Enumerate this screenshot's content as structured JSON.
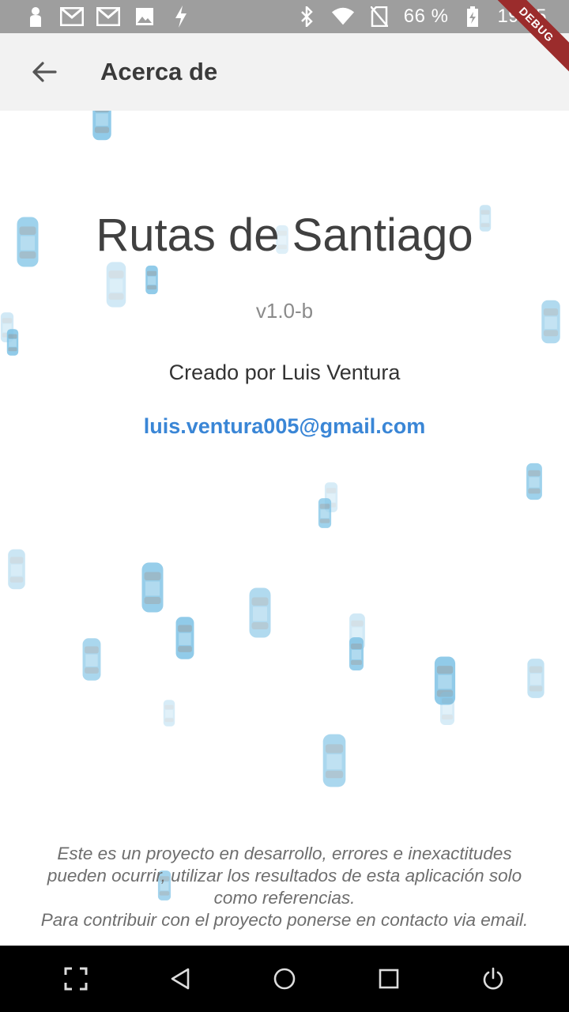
{
  "status_bar": {
    "battery": "66 %",
    "time": "19:25",
    "debug_label": "DEBUG",
    "left_icons": [
      "person-icon",
      "gmail-icon",
      "gmail-icon",
      "image-icon",
      "flash-icon"
    ],
    "right_icons": [
      "bluetooth-icon",
      "wifi-icon",
      "no-sim-icon",
      "battery-icon"
    ]
  },
  "app_bar": {
    "title": "Acerca de",
    "back_icon": "arrow-back-icon"
  },
  "about": {
    "app_name": "Rutas de Santiago",
    "version": "v1.0-b",
    "author": "Creado por Luis Ventura",
    "email": "luis.ventura005@gmail.com"
  },
  "footer": {
    "line1": "Este es un proyecto en desarrollo, errores e inexactitudes",
    "line2": "pueden ocurrir, utilizar los resultados de esta aplicación solo",
    "line3": "como referencias.",
    "line4": "Para contribuir con el proyecto ponerse en contacto via email."
  },
  "nav_bar": {
    "buttons": [
      "screenshot-icon",
      "back-triangle-icon",
      "home-circle-icon",
      "recents-square-icon",
      "power-icon"
    ]
  },
  "colors": {
    "status_bar": "#9e9e9e",
    "app_bar": "#f2f2f2",
    "link": "#3a86d6",
    "car": "#7ec3e6",
    "debug_ribbon": "#9b2c2c",
    "nav_bar": "#000000"
  }
}
